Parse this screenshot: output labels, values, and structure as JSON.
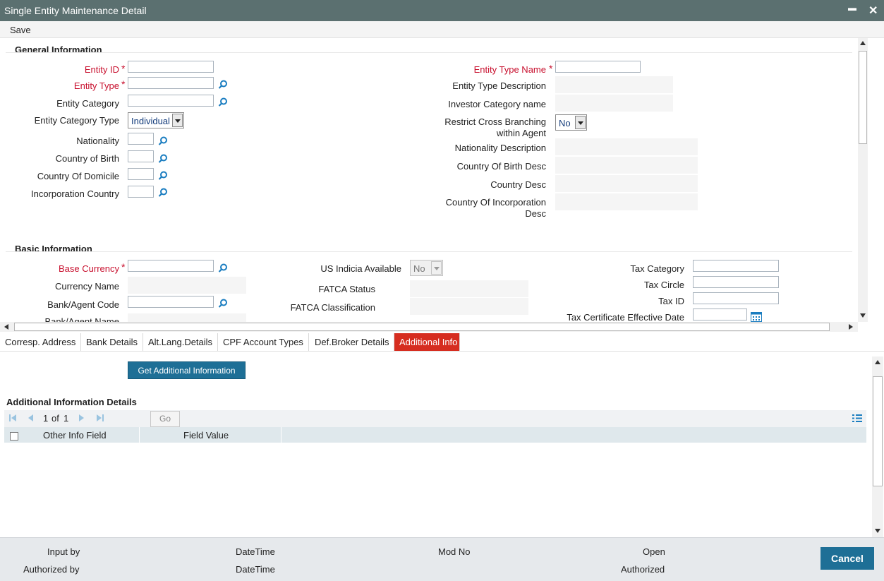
{
  "window": {
    "title": "Single Entity Maintenance Detail",
    "minimize_glyph": "▬",
    "close_glyph": "✕"
  },
  "menu": {
    "save": "Save"
  },
  "general": {
    "title": "General Information",
    "entity_id": "Entity ID",
    "entity_type": "Entity Type",
    "entity_category": "Entity Category",
    "entity_category_type": "Entity Category Type",
    "entity_category_type_value": "Individual",
    "nationality": "Nationality",
    "country_of_birth": "Country of Birth",
    "country_of_domicile": "Country Of Domicile",
    "incorporation_country": "Incorporation Country",
    "entity_type_name": "Entity Type Name",
    "entity_type_description": "Entity Type Description",
    "investor_category_name": "Investor Category name",
    "restrict_cross_branching": "Restrict Cross Branching within Agent",
    "restrict_cross_branching_value": "No",
    "nationality_description": "Nationality Description",
    "country_of_birth_desc": "Country Of Birth Desc",
    "country_desc": "Country Desc",
    "country_of_incorporation_desc": "Country Of Incorporation Desc",
    "required_marker": "*"
  },
  "basic": {
    "title": "Basic Information",
    "base_currency": "Base Currency",
    "currency_name": "Currency Name",
    "bank_agent_code": "Bank/Agent Code",
    "bank_agent_name": "Bank/Agent Name",
    "us_indicia_available": "US Indicia Available",
    "us_indicia_value": "No",
    "fatca_status": "FATCA Status",
    "fatca_classification": "FATCA Classification",
    "tax_category": "Tax Category",
    "tax_circle": "Tax Circle",
    "tax_id": "Tax ID",
    "tax_certificate_effective_date": "Tax Certificate Effective Date"
  },
  "tabs": [
    {
      "label": "Corresp. Address"
    },
    {
      "label": "Bank Details"
    },
    {
      "label": "Alt.Lang.Details"
    },
    {
      "label": "CPF Account Types"
    },
    {
      "label": "Def.Broker Details"
    },
    {
      "label": "Additional Info",
      "active": true
    }
  ],
  "additional": {
    "get_button": "Get Additional Information",
    "details_title": "Additional Information Details",
    "page_current": "1",
    "page_of": "of",
    "page_total": "1",
    "go": "Go",
    "columns": [
      "Other Info Field",
      "Field Value"
    ]
  },
  "footer": {
    "input_by": "Input by",
    "authorized_by": "Authorized by",
    "datetime1": "DateTime",
    "datetime2": "DateTime",
    "mod_no": "Mod No",
    "open": "Open",
    "authorized": "Authorized",
    "cancel": "Cancel"
  },
  "colors": {
    "titlebar": "#5b7070",
    "accent": "#1e6f96",
    "required": "#c8102e",
    "active_tab": "#d62d20"
  },
  "icons": [
    "search-icon",
    "calendar-icon",
    "first-page-icon",
    "prev-page-icon",
    "next-page-icon",
    "last-page-icon",
    "column-list-icon"
  ]
}
